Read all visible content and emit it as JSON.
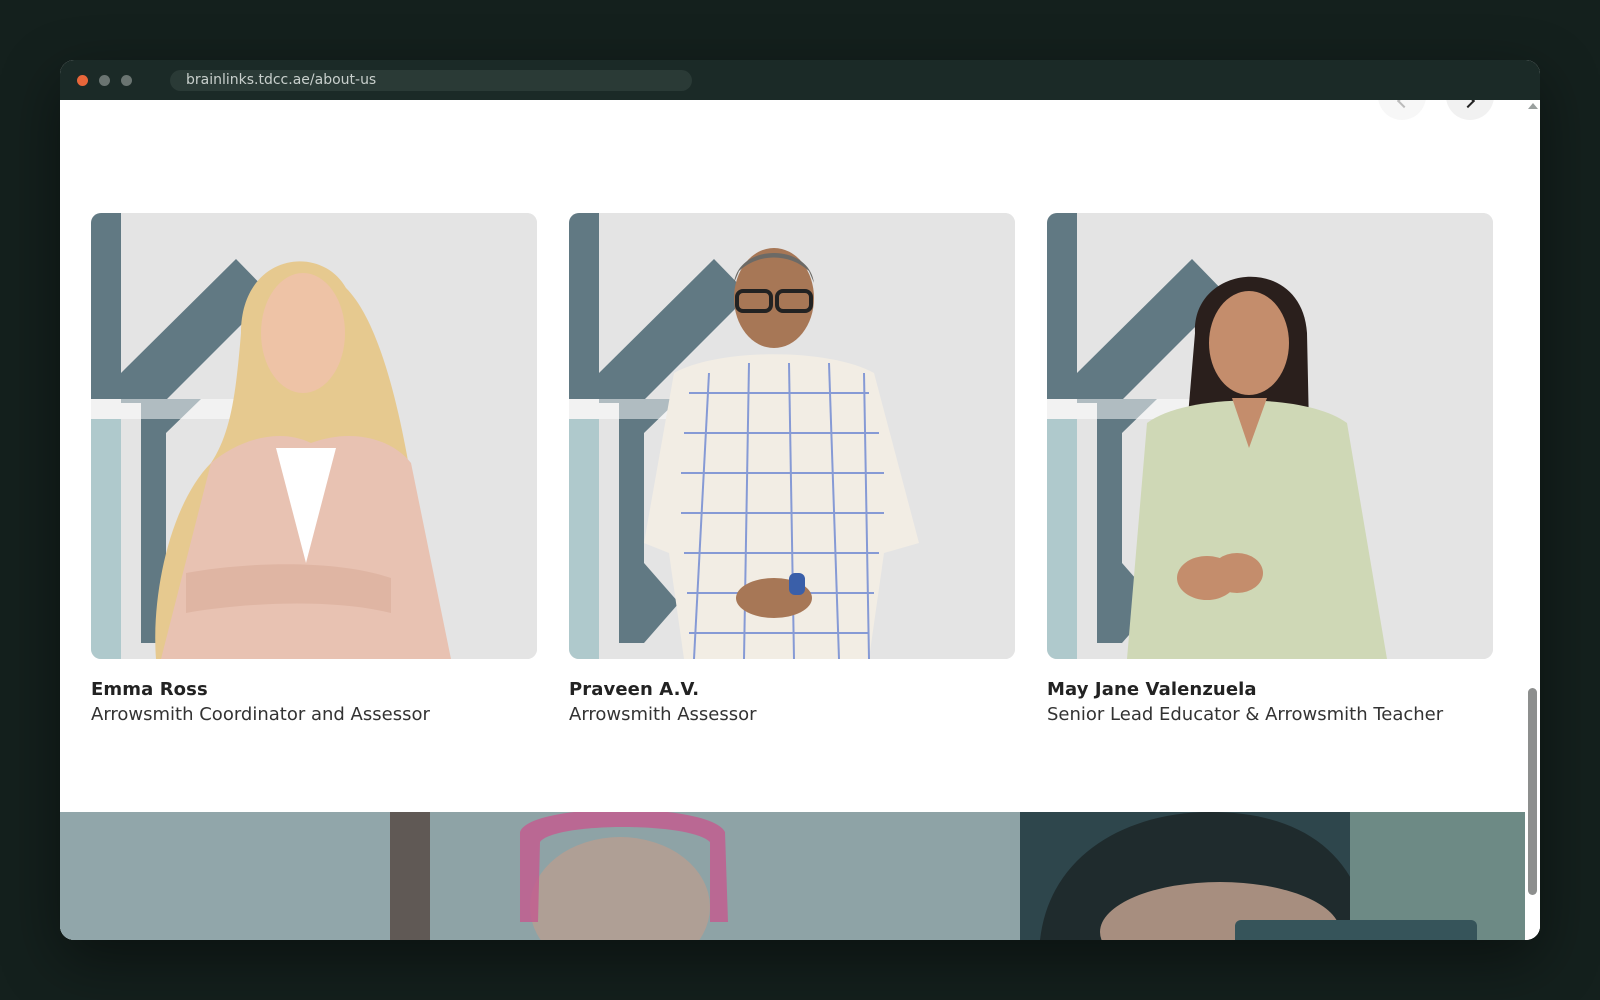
{
  "browser": {
    "url": "brainlinks.tdcc.ae/about-us"
  },
  "team": {
    "members": [
      {
        "name": "Emma Ross",
        "role": "Arrowsmith Coordinator and Assessor"
      },
      {
        "name": "Praveen A.V.",
        "role": "Arrowsmith Assessor"
      },
      {
        "name": "May Jane Valenzuela",
        "role": "Senior Lead Educator & Arrowsmith Teacher"
      }
    ]
  },
  "colors": {
    "chrome": "#1b2a27",
    "backdrop": "#14201d",
    "brand_slate": "#617983",
    "brand_aqua": "#afc9cc",
    "photo_bg": "#e4e4e4"
  }
}
